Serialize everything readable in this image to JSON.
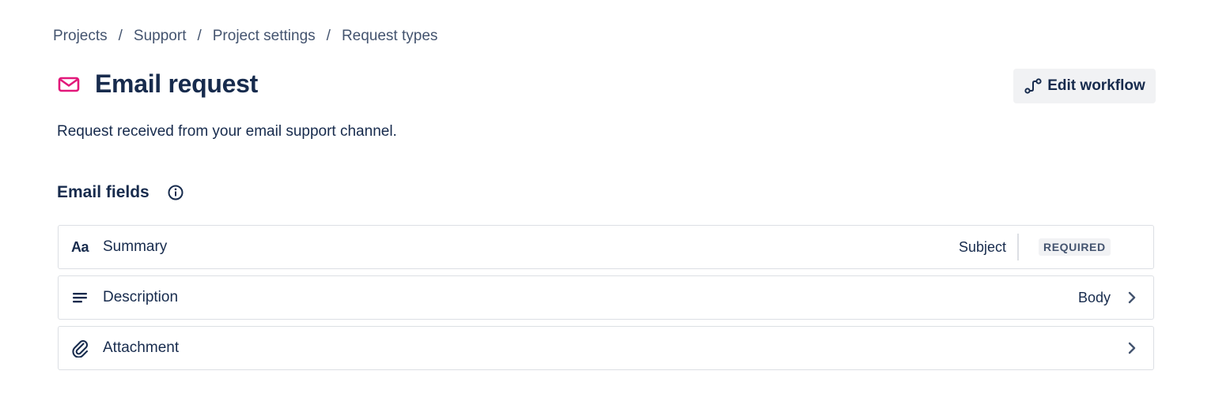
{
  "breadcrumb": {
    "items": [
      "Projects",
      "Support",
      "Project settings",
      "Request types"
    ],
    "separator": "/"
  },
  "header": {
    "title": "Email request",
    "icon": "envelope-icon",
    "icon_color": "#e2187a",
    "edit_workflow_label": "Edit workflow"
  },
  "description": "Request received from your email support channel.",
  "email_fields": {
    "title": "Email fields",
    "rows": [
      {
        "icon": "text-aa-icon",
        "icon_text": "Aa",
        "label": "Summary",
        "mapped_to": "Subject",
        "badge": "REQUIRED"
      },
      {
        "icon": "lines-icon",
        "label": "Description",
        "mapped_to": "Body"
      },
      {
        "icon": "paperclip-icon",
        "label": "Attachment"
      }
    ]
  }
}
